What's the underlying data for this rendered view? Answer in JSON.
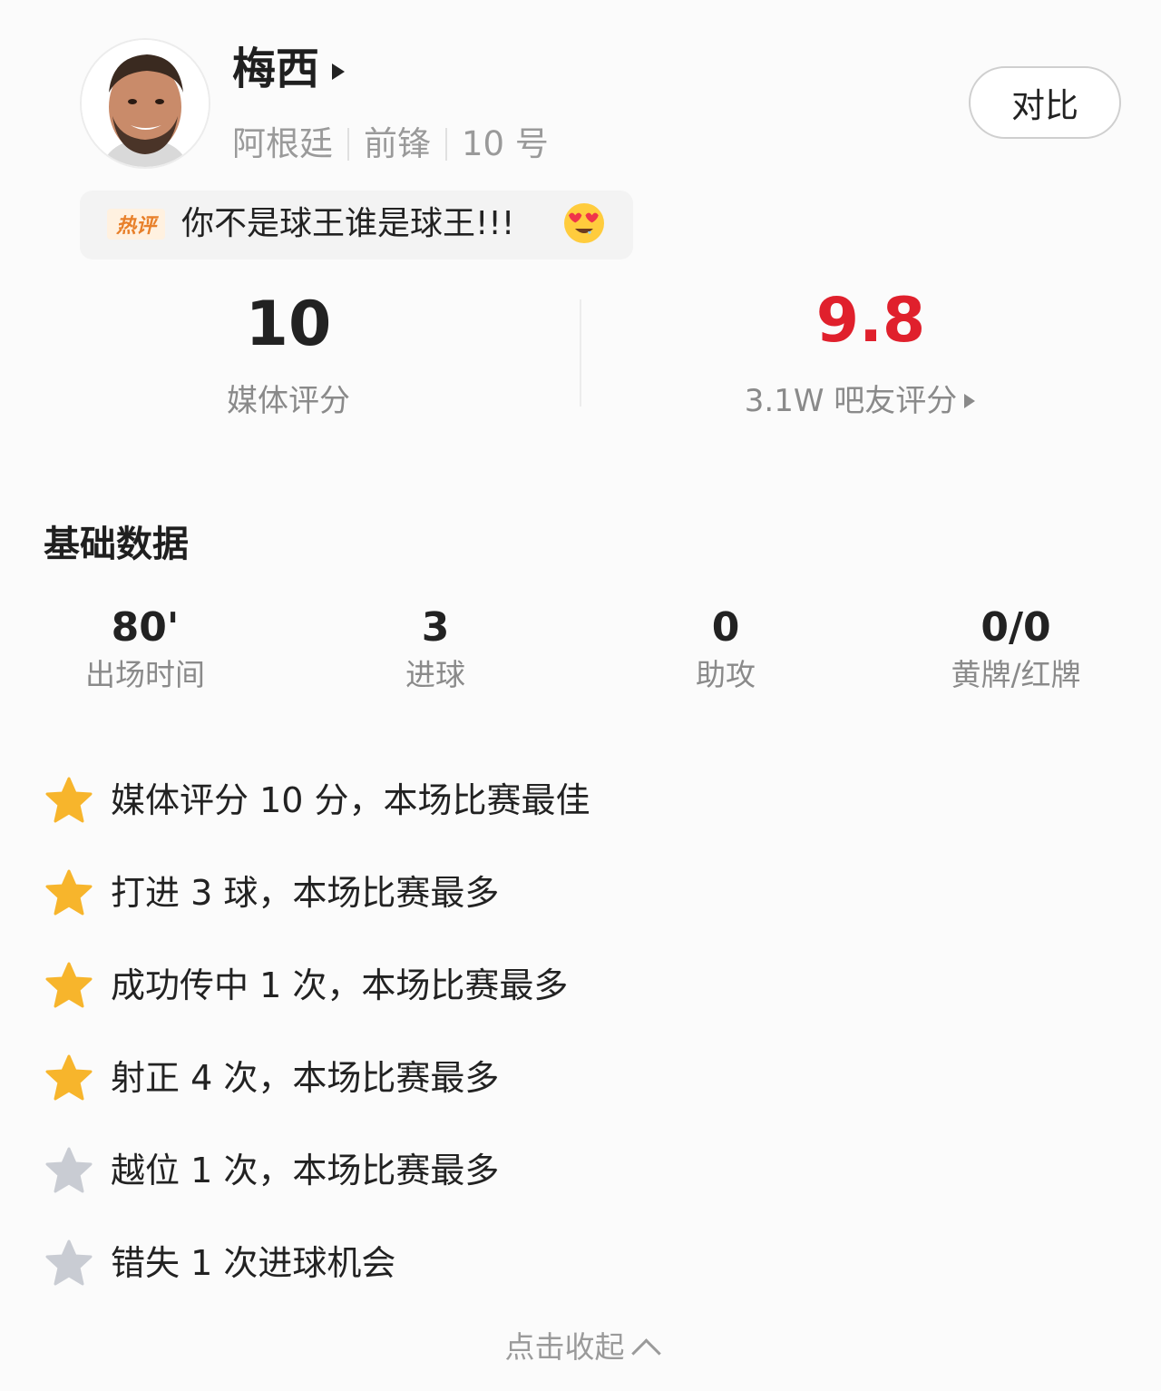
{
  "player": {
    "name": "梅西",
    "country": "阿根廷",
    "position": "前锋",
    "number": "10 号"
  },
  "compare_button": "对比",
  "hot_comment": {
    "tag": "热评",
    "text": "你不是球王谁是球王!!!",
    "emoji": "heart-eyes-emoji"
  },
  "ratings": {
    "media": {
      "value": "10",
      "label": "媒体评分"
    },
    "fans": {
      "value": "9.8",
      "label": "3.1W 吧友评分"
    }
  },
  "basic_data": {
    "title": "基础数据",
    "stats": [
      {
        "value": "80'",
        "label": "出场时间"
      },
      {
        "value": "3",
        "label": "进球"
      },
      {
        "value": "0",
        "label": "助攻"
      },
      {
        "value": "0/0",
        "label": "黄牌/红牌"
      }
    ]
  },
  "highlights": [
    {
      "star": "gold",
      "text": "媒体评分 10 分，本场比赛最佳"
    },
    {
      "star": "gold",
      "text": "打进 3 球，本场比赛最多"
    },
    {
      "star": "gold",
      "text": "成功传中 1 次，本场比赛最多"
    },
    {
      "star": "gold",
      "text": "射正 4 次，本场比赛最多"
    },
    {
      "star": "silver",
      "text": "越位 1 次，本场比赛最多"
    },
    {
      "star": "silver",
      "text": "错失 1 次进球机会"
    }
  ],
  "collapse_label": "点击收起",
  "colors": {
    "fan_rating": "#e0202c",
    "gold_star": "#f7b52c",
    "silver_star": "#c9ccd3",
    "hot_tag": "#e8802a"
  }
}
